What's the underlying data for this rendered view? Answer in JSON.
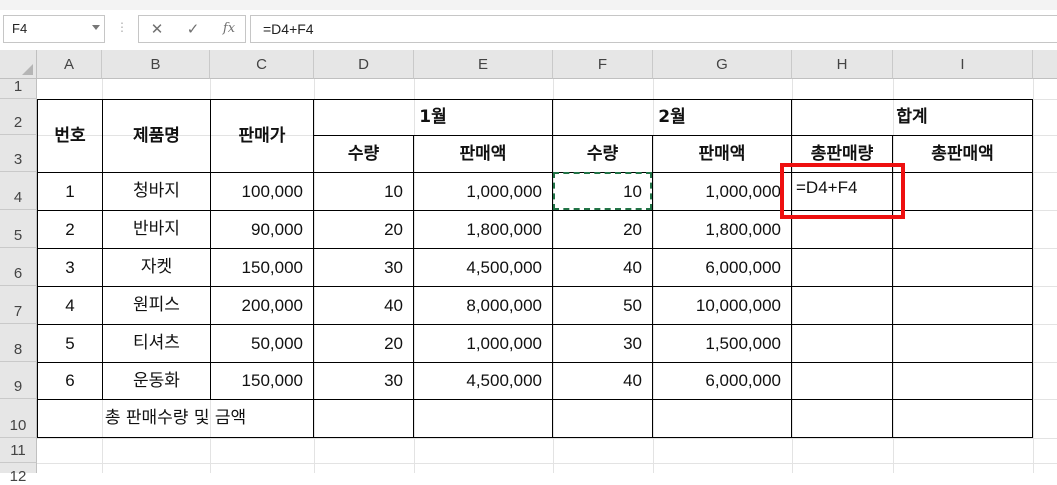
{
  "formula_bar": {
    "name_box": "F4",
    "separator": "⋮",
    "cancel_icon": "✕",
    "enter_icon": "✓",
    "fx_label": "fx",
    "formula": "=D4+F4"
  },
  "columns": [
    "A",
    "B",
    "C",
    "D",
    "E",
    "F",
    "G",
    "H",
    "I"
  ],
  "rows": [
    "1",
    "2",
    "3",
    "4",
    "5",
    "6",
    "7",
    "8",
    "9",
    "10",
    "11",
    "12"
  ],
  "table": {
    "header": {
      "no": "번호",
      "product": "제품명",
      "price": "판매가",
      "month1": "1월",
      "month2": "2월",
      "total": "합계",
      "qty1": "수량",
      "amount1": "판매액",
      "qty2": "수량",
      "amount2": "판매액",
      "total_qty": "총판매량",
      "total_amount": "총판매액"
    },
    "rows": [
      {
        "no": "1",
        "product": "청바지",
        "price": "100,000",
        "qty1": "10",
        "amount1": "1,000,000",
        "qty2": "10",
        "amount2": "1,000,000",
        "total_qty": "=D4+F4",
        "total_amount": ""
      },
      {
        "no": "2",
        "product": "반바지",
        "price": "90,000",
        "qty1": "20",
        "amount1": "1,800,000",
        "qty2": "20",
        "amount2": "1,800,000",
        "total_qty": "",
        "total_amount": ""
      },
      {
        "no": "3",
        "product": "자켓",
        "price": "150,000",
        "qty1": "30",
        "amount1": "4,500,000",
        "qty2": "40",
        "amount2": "6,000,000",
        "total_qty": "",
        "total_amount": ""
      },
      {
        "no": "4",
        "product": "원피스",
        "price": "200,000",
        "qty1": "40",
        "amount1": "8,000,000",
        "qty2": "50",
        "amount2": "10,000,000",
        "total_qty": "",
        "total_amount": ""
      },
      {
        "no": "5",
        "product": "티셔츠",
        "price": "50,000",
        "qty1": "20",
        "amount1": "1,000,000",
        "qty2": "30",
        "amount2": "1,500,000",
        "total_qty": "",
        "total_amount": ""
      },
      {
        "no": "6",
        "product": "운동화",
        "price": "150,000",
        "qty1": "30",
        "amount1": "4,500,000",
        "qty2": "40",
        "amount2": "6,000,000",
        "total_qty": "",
        "total_amount": ""
      }
    ],
    "total_row_label": "총 판매수량 및 금액"
  },
  "colors": {
    "copy_marquee": "#217346",
    "highlight_box": "#ee1010"
  }
}
